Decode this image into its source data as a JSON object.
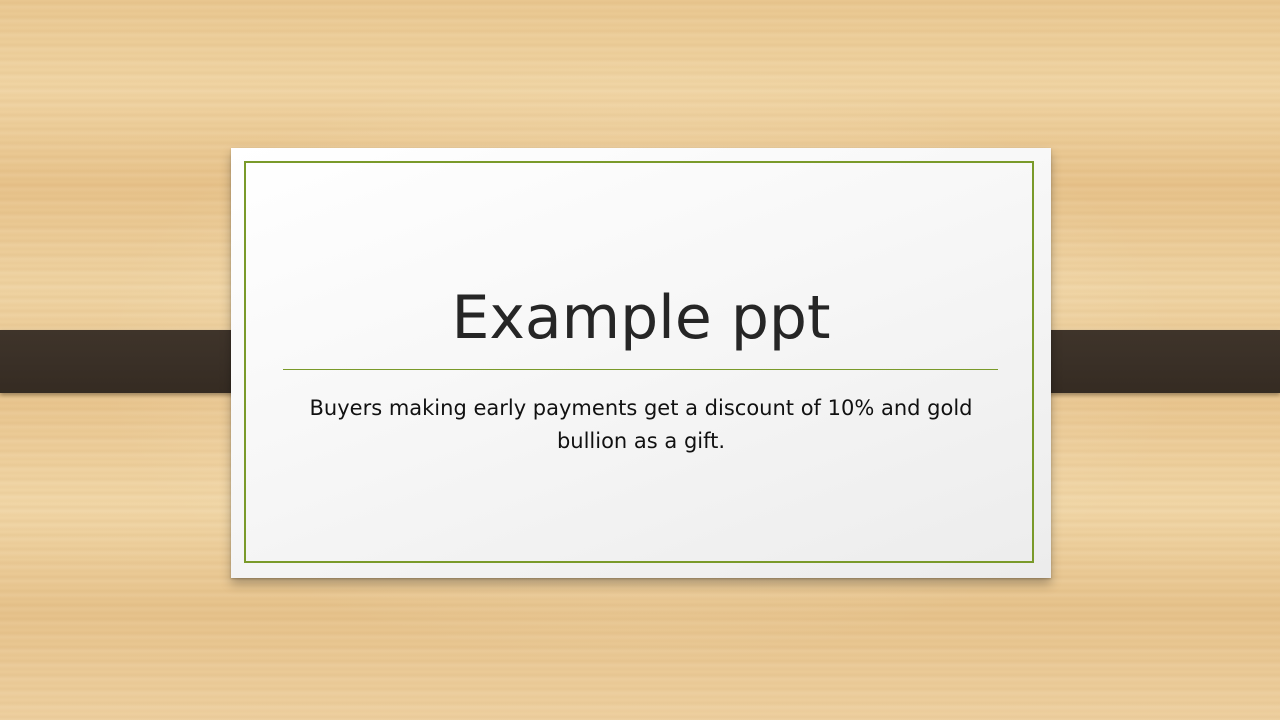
{
  "slide": {
    "title": "Example ppt",
    "subtitle": "Buyers making early payments get a discount of 10% and gold bullion as a gift."
  },
  "colors": {
    "accent": "#7a9a2a",
    "strap": "#3a3027",
    "background": "#ecc993",
    "card": "#f7f7f7",
    "title_text": "#262626",
    "subtitle_text": "#111111"
  }
}
